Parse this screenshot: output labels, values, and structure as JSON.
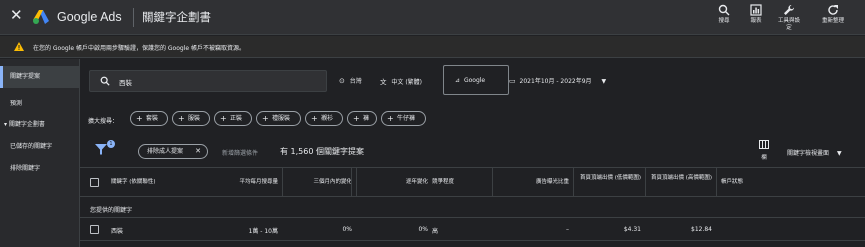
{
  "header": {
    "app_name": "Google Ads",
    "page_title": "關鍵字企劃書",
    "tools": [
      {
        "label": "搜尋",
        "icon": "search-icon"
      },
      {
        "label": "報表",
        "icon": "reports-icon"
      },
      {
        "label": "工具與設定",
        "icon": "wrench-icon"
      },
      {
        "label": "重新整理",
        "icon": "refresh-icon"
      }
    ]
  },
  "warning": {
    "text": "在您的 Google 帳戶中啟用兩步驟驗證，保護您的 Google 帳戶不被竊取資源。"
  },
  "sidebar": {
    "items": [
      {
        "label": "關鍵字提案",
        "active": true
      },
      {
        "label": "預測",
        "active": false
      },
      {
        "label": "▾ 關鍵字企劃書",
        "active": false
      },
      {
        "label": "已儲存的關鍵字",
        "active": false
      },
      {
        "label": "排除關鍵字",
        "active": false
      }
    ]
  },
  "search": {
    "value": "西裝",
    "location": "台灣",
    "language": "中文 (繁體)",
    "network": "Google",
    "date_range": "2021年10月 - 2022年9月"
  },
  "refine": {
    "label": "擴大搜尋：",
    "chips": [
      "套裝",
      "服裝",
      "正裝",
      "禮服裝",
      "襯衫",
      "褲",
      "牛仔褲"
    ]
  },
  "filters": {
    "badge_count": "1",
    "exclude_chip": "排除成人提案",
    "add_filter": "新增篩選條件",
    "result_count": "有 1,560 個關鍵字提案",
    "columns_label": "欄",
    "view_selector": "關鍵字檢視畫面"
  },
  "table": {
    "headers": {
      "keyword": "關鍵字 (依關聯性)",
      "monthly": "平均每月搜尋量",
      "three_month": "三個月內的變化",
      "yoy": "逐年變化",
      "competition": "競爭程度",
      "impression_share": "廣告曝光比重",
      "bid_low": "首頁頂端出價 (低價範圍)",
      "bid_high": "首頁頂端出價 (高價範圍)",
      "account_status": "帳戶狀態"
    },
    "group_label": "您提供的關鍵字",
    "rows": [
      {
        "keyword": "西裝",
        "monthly": "1萬 - 10萬",
        "three_month": "0%",
        "yoy": "0%",
        "competition": "高",
        "impression_share": "–",
        "bid_low": "$4.31",
        "bid_high": "$12.84",
        "account_status": ""
      }
    ]
  }
}
